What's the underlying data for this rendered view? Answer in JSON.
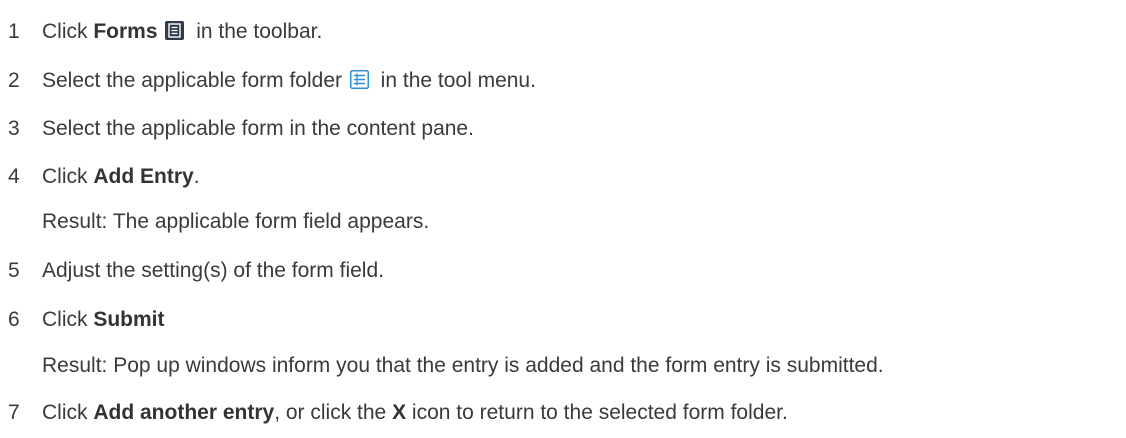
{
  "steps": [
    {
      "number": "1",
      "pre": "Click ",
      "bold": "Forms",
      "post": " in the toolbar.",
      "icon": "form-icon-dark"
    },
    {
      "number": "2",
      "pre": "Select the applicable form folder ",
      "post": " in the tool menu.",
      "icon": "form-folder-icon-blue"
    },
    {
      "number": "3",
      "text": "Select the applicable form in the content pane."
    },
    {
      "number": "4",
      "pre": "Click ",
      "bold": "Add Entry",
      "post": "."
    },
    {
      "result": "Result: The applicable form field appears."
    },
    {
      "number": "5",
      "text": "Adjust the setting(s) of the form field."
    },
    {
      "number": "6",
      "pre": "Click ",
      "bold": "Submit",
      "post": ""
    },
    {
      "result": "Result: Pop up windows inform you that the entry is added and the form entry is submitted."
    },
    {
      "number": "7",
      "pre": "Click ",
      "bold": "Add another entry",
      "mid": ", or click the ",
      "bold2": "X",
      "post": " icon to return to the selected form folder."
    }
  ],
  "colors": {
    "text": "#3a3a3a",
    "icon_dark": "#2f3a4a",
    "icon_blue": "#2f8fd8"
  }
}
